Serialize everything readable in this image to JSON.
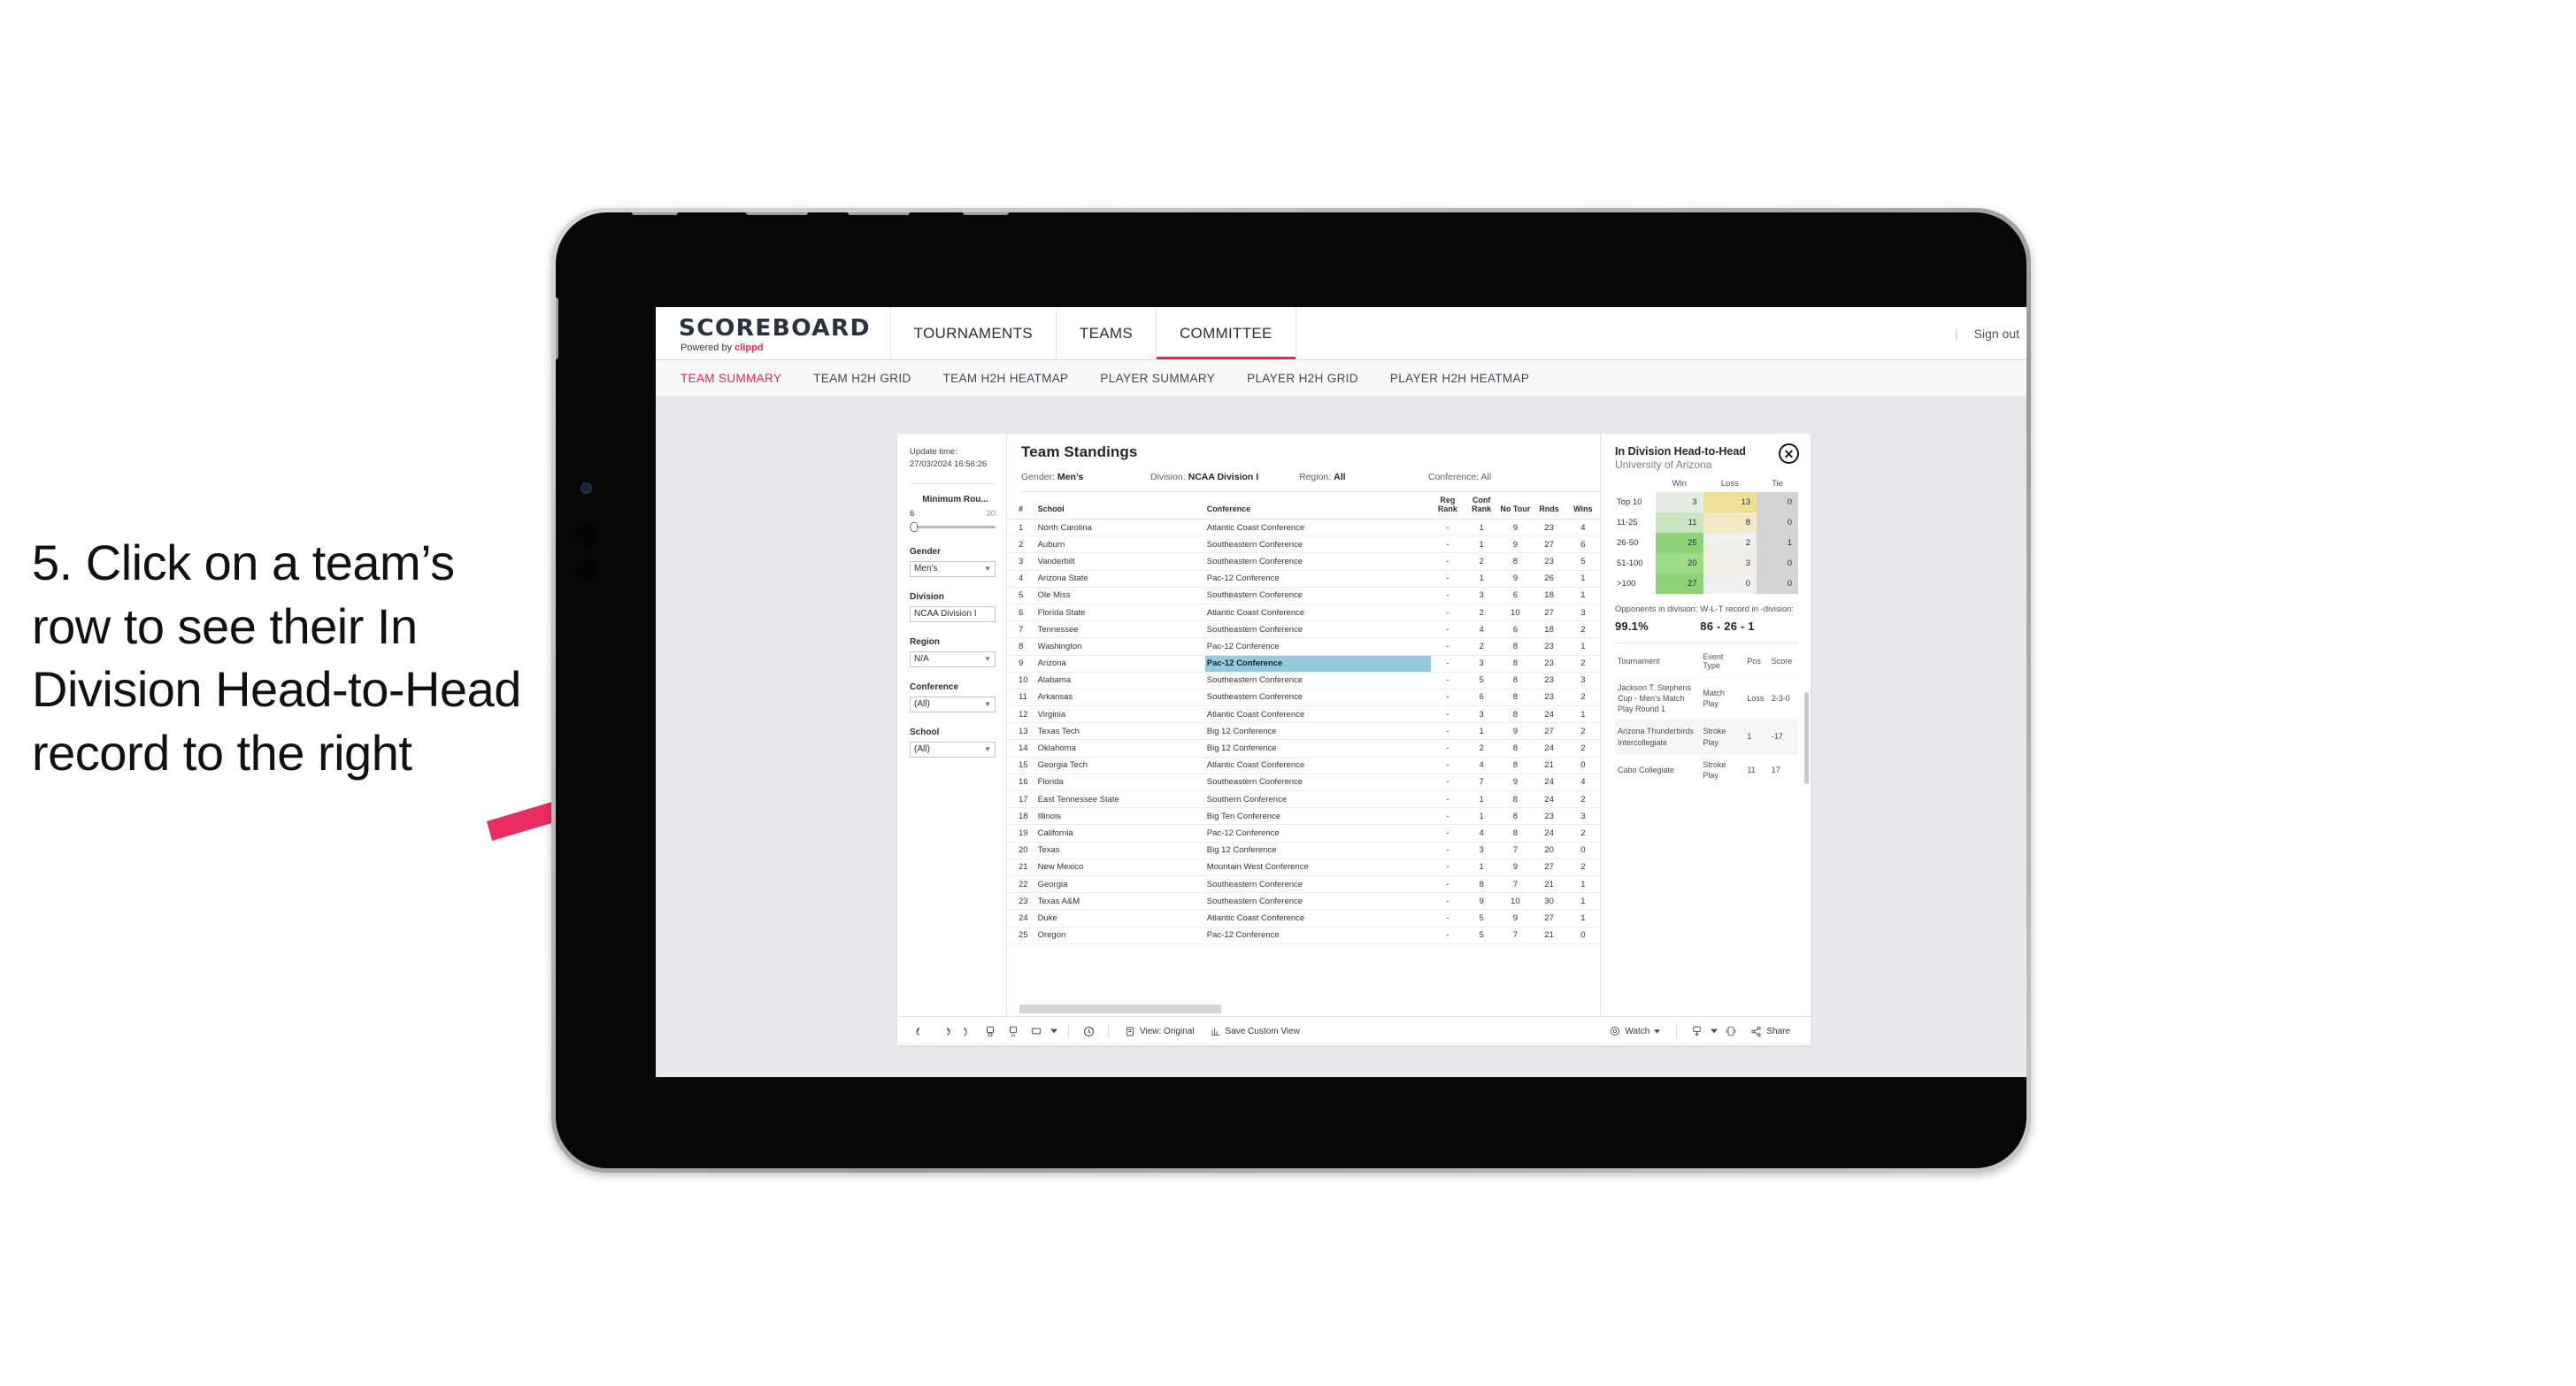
{
  "annotation": {
    "text": "5. Click on a team’s row to see their In Division Head-to-Head record to the right",
    "arrow_color": "#ec2d62"
  },
  "header": {
    "logo_title": "SCOREBOARD",
    "logo_sub_prefix": "Powered by ",
    "logo_sub_brand": "clippd",
    "nav": [
      {
        "label": "TOURNAMENTS",
        "active": false
      },
      {
        "label": "TEAMS",
        "active": false
      },
      {
        "label": "COMMITTEE",
        "active": true
      }
    ],
    "separator": "|",
    "sign_out": "Sign out"
  },
  "subnav": [
    {
      "label": "TEAM SUMMARY",
      "active": true
    },
    {
      "label": "TEAM H2H GRID",
      "active": false
    },
    {
      "label": "TEAM H2H HEATMAP",
      "active": false
    },
    {
      "label": "PLAYER SUMMARY",
      "active": false
    },
    {
      "label": "PLAYER H2H GRID",
      "active": false
    },
    {
      "label": "PLAYER H2H HEATMAP",
      "active": false
    }
  ],
  "filters": {
    "update_time_label": "Update time:",
    "update_time_value": "27/03/2024 16:56:26",
    "min_rounds": {
      "label": "Minimum Rou...",
      "min": "6",
      "max": "30"
    },
    "groups": [
      {
        "label": "Gender",
        "value": "Men’s"
      },
      {
        "label": "Division",
        "value": "NCAA Division I"
      },
      {
        "label": "Region",
        "value": "N/A"
      },
      {
        "label": "Conference",
        "value": "(All)"
      },
      {
        "label": "School",
        "value": "(All)"
      }
    ]
  },
  "standings": {
    "title": "Team Standings",
    "filter_summary": [
      {
        "label": "Gender:",
        "value": "Men’s"
      },
      {
        "label": "Division:",
        "value": "NCAA Division I"
      },
      {
        "label": "Region:",
        "value": "All"
      },
      {
        "label": "Conference:",
        "value": "All"
      }
    ],
    "columns": [
      "#",
      "School",
      "Conference",
      "Reg Rank",
      "Conf Rank",
      "No Tour",
      "Rnds",
      "Wins"
    ],
    "selected_row_index": 8,
    "rows": [
      {
        "rank": "1",
        "school": "North Carolina",
        "conference": "Atlantic Coast Conference",
        "reg_rank": "-",
        "conf_rank": "1",
        "no_tour": "9",
        "rnds": "23",
        "wins": "4"
      },
      {
        "rank": "2",
        "school": "Auburn",
        "conference": "Southeastern Conference",
        "reg_rank": "-",
        "conf_rank": "1",
        "no_tour": "9",
        "rnds": "27",
        "wins": "6"
      },
      {
        "rank": "3",
        "school": "Vanderbilt",
        "conference": "Southeastern Conference",
        "reg_rank": "-",
        "conf_rank": "2",
        "no_tour": "8",
        "rnds": "23",
        "wins": "5"
      },
      {
        "rank": "4",
        "school": "Arizona State",
        "conference": "Pac-12 Conference",
        "reg_rank": "-",
        "conf_rank": "1",
        "no_tour": "9",
        "rnds": "26",
        "wins": "1"
      },
      {
        "rank": "5",
        "school": "Ole Miss",
        "conference": "Southeastern Conference",
        "reg_rank": "-",
        "conf_rank": "3",
        "no_tour": "6",
        "rnds": "18",
        "wins": "1"
      },
      {
        "rank": "6",
        "school": "Florida State",
        "conference": "Atlantic Coast Conference",
        "reg_rank": "-",
        "conf_rank": "2",
        "no_tour": "10",
        "rnds": "27",
        "wins": "3"
      },
      {
        "rank": "7",
        "school": "Tennessee",
        "conference": "Southeastern Conference",
        "reg_rank": "-",
        "conf_rank": "4",
        "no_tour": "6",
        "rnds": "18",
        "wins": "2"
      },
      {
        "rank": "8",
        "school": "Washington",
        "conference": "Pac-12 Conference",
        "reg_rank": "-",
        "conf_rank": "2",
        "no_tour": "8",
        "rnds": "23",
        "wins": "1"
      },
      {
        "rank": "9",
        "school": "Arizona",
        "conference": "Pac-12 Conference",
        "reg_rank": "-",
        "conf_rank": "3",
        "no_tour": "8",
        "rnds": "23",
        "wins": "2"
      },
      {
        "rank": "10",
        "school": "Alabama",
        "conference": "Southeastern Conference",
        "reg_rank": "-",
        "conf_rank": "5",
        "no_tour": "8",
        "rnds": "23",
        "wins": "3"
      },
      {
        "rank": "11",
        "school": "Arkansas",
        "conference": "Southeastern Conference",
        "reg_rank": "-",
        "conf_rank": "6",
        "no_tour": "8",
        "rnds": "23",
        "wins": "2"
      },
      {
        "rank": "12",
        "school": "Virginia",
        "conference": "Atlantic Coast Conference",
        "reg_rank": "-",
        "conf_rank": "3",
        "no_tour": "8",
        "rnds": "24",
        "wins": "1"
      },
      {
        "rank": "13",
        "school": "Texas Tech",
        "conference": "Big 12 Conference",
        "reg_rank": "-",
        "conf_rank": "1",
        "no_tour": "9",
        "rnds": "27",
        "wins": "2"
      },
      {
        "rank": "14",
        "school": "Oklahoma",
        "conference": "Big 12 Conference",
        "reg_rank": "-",
        "conf_rank": "2",
        "no_tour": "8",
        "rnds": "24",
        "wins": "2"
      },
      {
        "rank": "15",
        "school": "Georgia Tech",
        "conference": "Atlantic Coast Conference",
        "reg_rank": "-",
        "conf_rank": "4",
        "no_tour": "8",
        "rnds": "21",
        "wins": "0"
      },
      {
        "rank": "16",
        "school": "Florida",
        "conference": "Southeastern Conference",
        "reg_rank": "-",
        "conf_rank": "7",
        "no_tour": "9",
        "rnds": "24",
        "wins": "4"
      },
      {
        "rank": "17",
        "school": "East Tennessee State",
        "conference": "Southern Conference",
        "reg_rank": "-",
        "conf_rank": "1",
        "no_tour": "8",
        "rnds": "24",
        "wins": "2"
      },
      {
        "rank": "18",
        "school": "Illinois",
        "conference": "Big Ten Conference",
        "reg_rank": "-",
        "conf_rank": "1",
        "no_tour": "8",
        "rnds": "23",
        "wins": "3"
      },
      {
        "rank": "19",
        "school": "California",
        "conference": "Pac-12 Conference",
        "reg_rank": "-",
        "conf_rank": "4",
        "no_tour": "8",
        "rnds": "24",
        "wins": "2"
      },
      {
        "rank": "20",
        "school": "Texas",
        "conference": "Big 12 Conference",
        "reg_rank": "-",
        "conf_rank": "3",
        "no_tour": "7",
        "rnds": "20",
        "wins": "0"
      },
      {
        "rank": "21",
        "school": "New Mexico",
        "conference": "Mountain West Conference",
        "reg_rank": "-",
        "conf_rank": "1",
        "no_tour": "9",
        "rnds": "27",
        "wins": "2"
      },
      {
        "rank": "22",
        "school": "Georgia",
        "conference": "Southeastern Conference",
        "reg_rank": "-",
        "conf_rank": "8",
        "no_tour": "7",
        "rnds": "21",
        "wins": "1"
      },
      {
        "rank": "23",
        "school": "Texas A&M",
        "conference": "Southeastern Conference",
        "reg_rank": "-",
        "conf_rank": "9",
        "no_tour": "10",
        "rnds": "30",
        "wins": "1"
      },
      {
        "rank": "24",
        "school": "Duke",
        "conference": "Atlantic Coast Conference",
        "reg_rank": "-",
        "conf_rank": "5",
        "no_tour": "9",
        "rnds": "27",
        "wins": "1"
      },
      {
        "rank": "25",
        "school": "Oregon",
        "conference": "Pac-12 Conference",
        "reg_rank": "-",
        "conf_rank": "5",
        "no_tour": "7",
        "rnds": "21",
        "wins": "0"
      }
    ]
  },
  "detail": {
    "title": "In Division Head-to-Head",
    "subtitle": "University of Arizona",
    "close_glyph": "✕",
    "stats": [
      {
        "label": "Opponents in division:",
        "value": "99.1%"
      },
      {
        "label": "W-L-T record in -division:",
        "value": "86 - 26 - 1"
      }
    ],
    "tournament_columns": [
      "Tournament",
      "Event Type",
      "Pos",
      "Score"
    ],
    "tournaments": [
      {
        "name": "Jackson T. Stephens Cup - Men’s Match Play Round 1",
        "type": "Match Play",
        "pos": "Loss",
        "score": "2-3-0"
      },
      {
        "name": "Arizona Thunderbirds Intercollegiate",
        "type": "Stroke Play",
        "pos": "1",
        "score": "-17"
      },
      {
        "name": "Cabo Collegiate",
        "type": "Stroke Play",
        "pos": "11",
        "score": "17"
      }
    ]
  },
  "chart_data": {
    "type": "heatmap",
    "title": "In Division Head-to-Head",
    "subtitle": "University of Arizona",
    "xlabel": "",
    "ylabel": "",
    "columns": [
      "Win",
      "Loss",
      "Tie"
    ],
    "rows": [
      "Top 10",
      "11-25",
      "26-50",
      "51-100",
      ">100"
    ],
    "values": [
      [
        3,
        13,
        0
      ],
      [
        11,
        8,
        0
      ],
      [
        25,
        2,
        1
      ],
      [
        20,
        3,
        0
      ],
      [
        27,
        0,
        0
      ]
    ],
    "cell_colors": [
      [
        "#e4efe2",
        "#f0e096",
        "#d4d4d4"
      ],
      [
        "#cbe7c2",
        "#f3e9c4",
        "#d4d4d4"
      ],
      [
        "#8ed278",
        "#f0f0ec",
        "#d4d4d4"
      ],
      [
        "#9edb88",
        "#f1eee6",
        "#d4d4d4"
      ],
      [
        "#8ed278",
        "#f0f0f0",
        "#d4d4d4"
      ]
    ],
    "legend": "none",
    "grid": false
  },
  "toolbar": {
    "icons": [
      "undo-icon",
      "redo-icon",
      "revert-icon",
      "refresh-data-icon",
      "pause-icon",
      "rectangle-select-icon",
      "chevron-down-icon",
      "history-icon"
    ],
    "view_label": "View: Original",
    "save_label": "Save Custom View",
    "watch_label": "Watch",
    "share_label": "Share"
  }
}
